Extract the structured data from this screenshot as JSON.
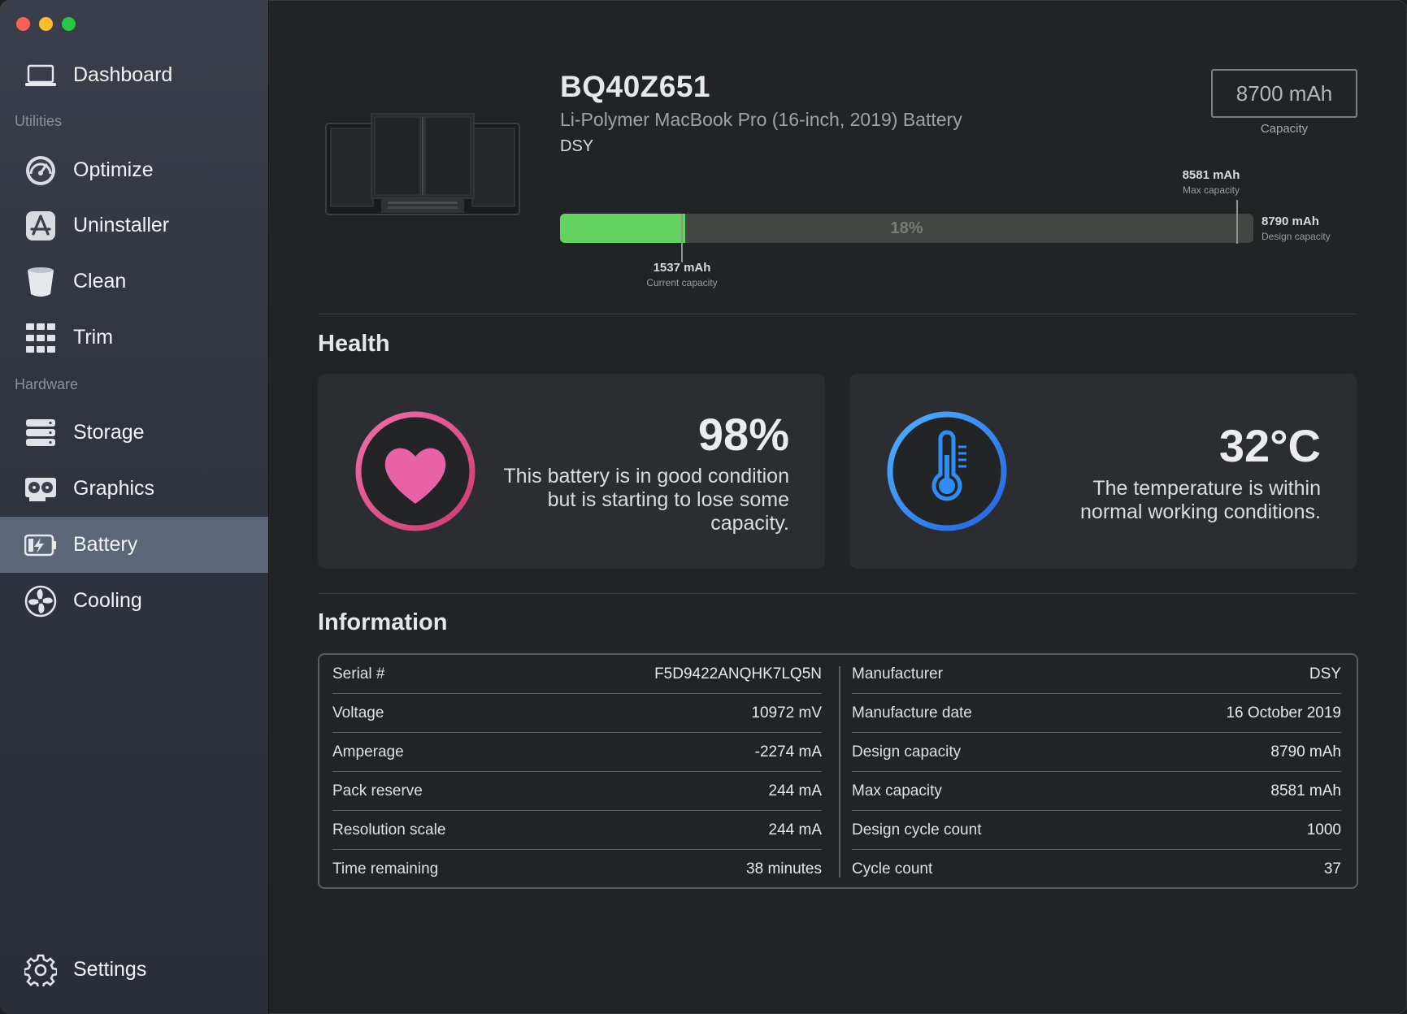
{
  "sidebar": {
    "items": [
      {
        "label": "Dashboard",
        "icon": "laptop-icon"
      },
      {
        "label": "Optimize",
        "icon": "speedometer-icon"
      },
      {
        "label": "Uninstaller",
        "icon": "app-store-icon"
      },
      {
        "label": "Clean",
        "icon": "trash-bin-icon"
      },
      {
        "label": "Trim",
        "icon": "grid-icon"
      },
      {
        "label": "Storage",
        "icon": "storage-drive-icon"
      },
      {
        "label": "Graphics",
        "icon": "graphics-card-icon"
      },
      {
        "label": "Battery",
        "icon": "battery-icon"
      },
      {
        "label": "Cooling",
        "icon": "fan-icon"
      }
    ],
    "sections": {
      "utilities": "Utilities",
      "hardware": "Hardware"
    },
    "active": "Battery",
    "settings_label": "Settings"
  },
  "battery": {
    "model": "BQ40Z651",
    "description": "Li-Polymer MacBook Pro (16-inch, 2019) Battery",
    "brand": "DSY",
    "capacity_value": "8700 mAh",
    "capacity_label": "Capacity",
    "bar": {
      "percent_label": "18%",
      "fill_fraction": 0.18,
      "current_value": "1537 mAh",
      "current_label": "Current capacity",
      "max_value": "8581 mAh",
      "max_label": "Max capacity",
      "design_value": "8790 mAh",
      "design_label": "Design capacity",
      "accent_color": "#63d25e"
    }
  },
  "health": {
    "title": "Health",
    "condition": {
      "value": "98%",
      "line1": "This battery is in good condition",
      "line2": "but is starting to lose some",
      "line3": "capacity.",
      "icon": "heart-icon",
      "color": "#e0508d"
    },
    "temperature": {
      "value": "32°C",
      "line1": "The temperature is within",
      "line2": "normal working conditions.",
      "icon": "thermometer-icon",
      "color": "#2f8cf5"
    }
  },
  "information": {
    "title": "Information",
    "left": [
      {
        "key": "Serial #",
        "value": "F5D9422ANQHK7LQ5N"
      },
      {
        "key": "Voltage",
        "value": "10972 mV"
      },
      {
        "key": "Amperage",
        "value": "-2274 mA"
      },
      {
        "key": "Pack reserve",
        "value": "244 mA"
      },
      {
        "key": "Resolution scale",
        "value": "244 mA"
      },
      {
        "key": "Time remaining",
        "value": "38 minutes"
      }
    ],
    "right": [
      {
        "key": "Manufacturer",
        "value": "DSY"
      },
      {
        "key": "Manufacture date",
        "value": "16 October 2019"
      },
      {
        "key": "Design capacity",
        "value": "8790 mAh"
      },
      {
        "key": "Max capacity",
        "value": "8581 mAh"
      },
      {
        "key": "Design cycle count",
        "value": "1000"
      },
      {
        "key": "Cycle count",
        "value": "37"
      }
    ]
  }
}
